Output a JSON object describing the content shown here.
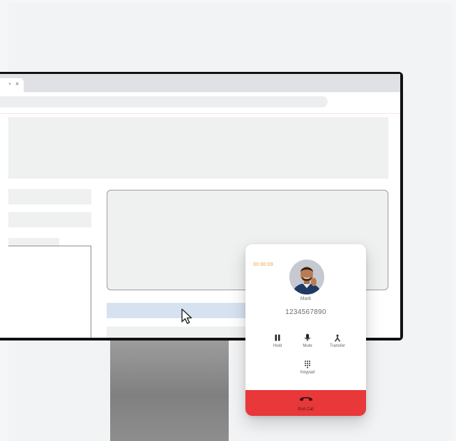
{
  "browser": {
    "tab": {
      "close_glyph": "×",
      "icon": "tab-favicon-dot"
    },
    "address_bar": {
      "value": ""
    }
  },
  "call_widget": {
    "timer": "00:00:09",
    "caller_name": "Mark",
    "caller_number": "1234567890",
    "controls": [
      {
        "label": "Hold",
        "icon": "pause-icon"
      },
      {
        "label": "Mute",
        "icon": "microphone-icon"
      },
      {
        "label": "Transfer",
        "icon": "transfer-icon"
      },
      {
        "label": "Keypad",
        "icon": "keypad-icon"
      }
    ],
    "end_call_label": "End Call"
  },
  "colors": {
    "timer": "#e8a23a",
    "end_call_bg": "#e8383a",
    "selection": "#d7e2f1",
    "monitor_bezel": "#111111"
  }
}
